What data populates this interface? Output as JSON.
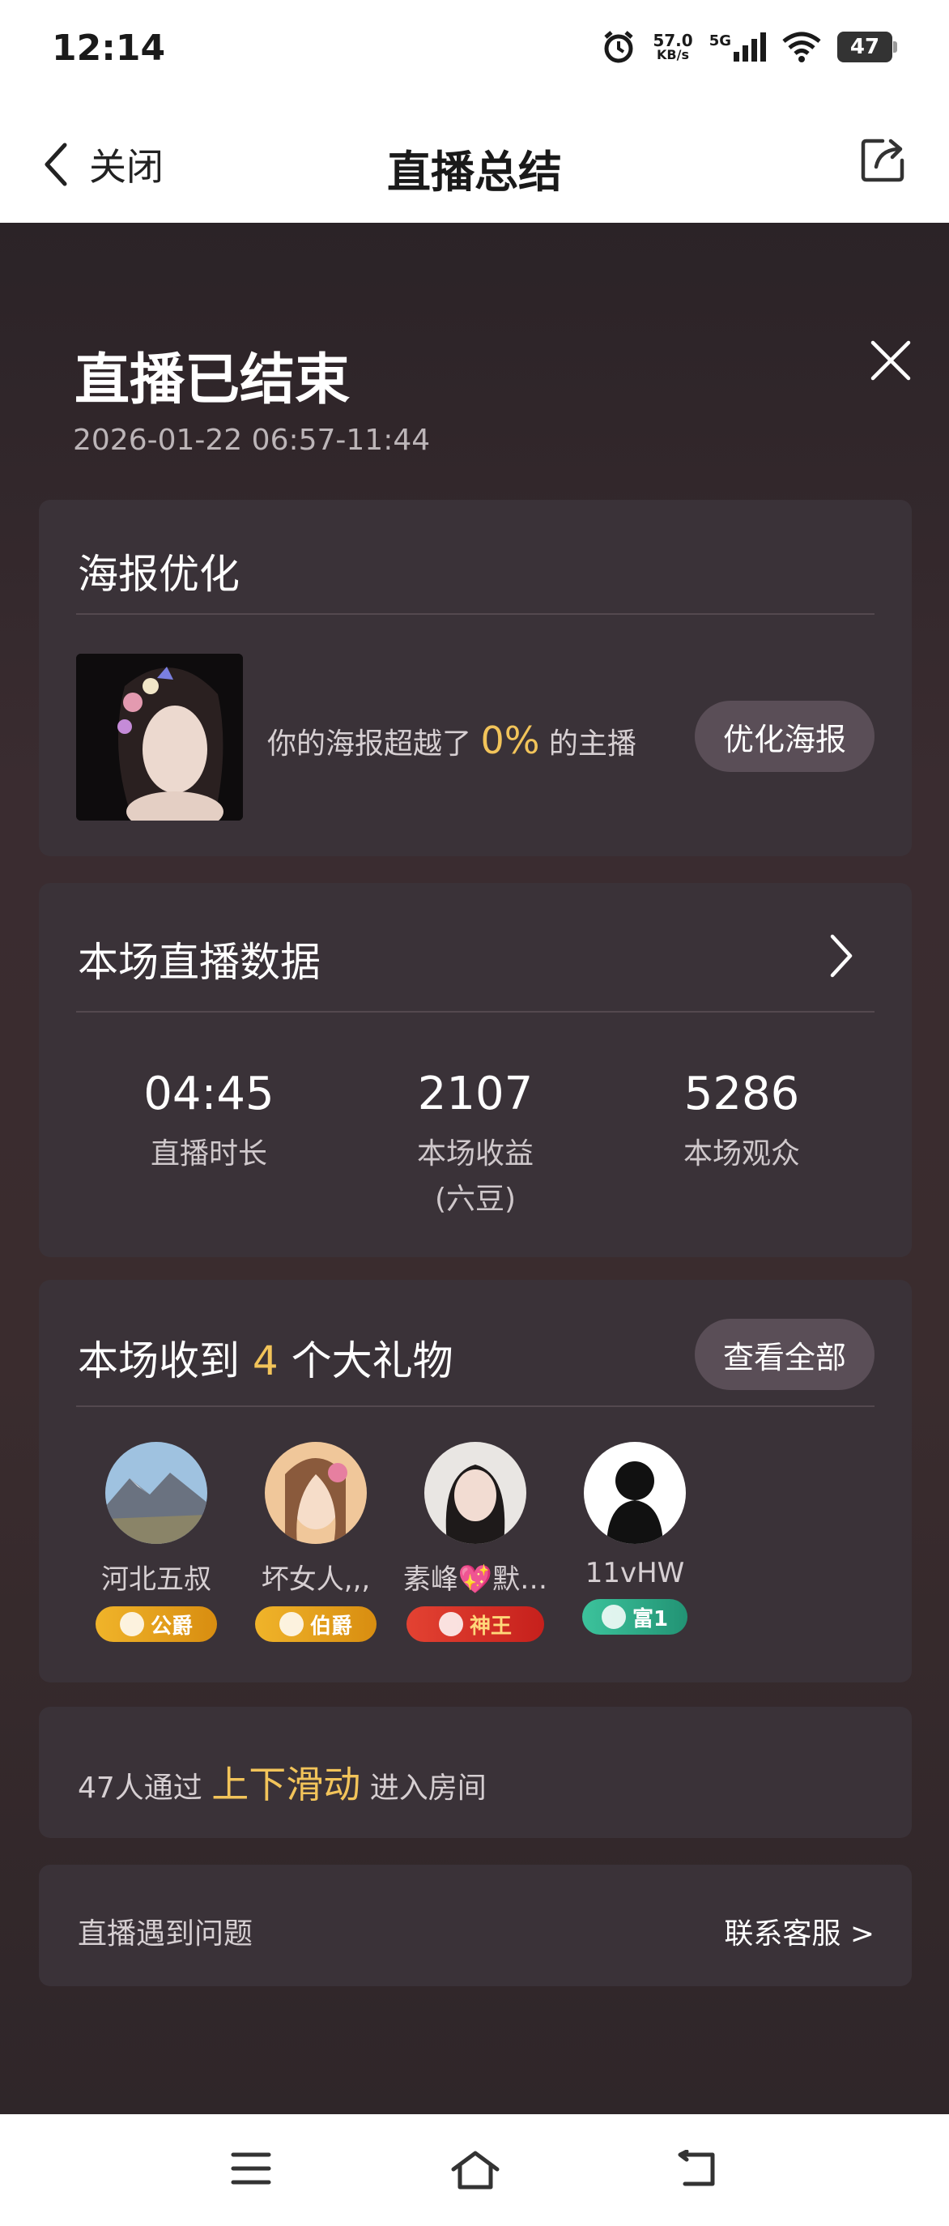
{
  "status_bar": {
    "time": "12:14",
    "net_speed_value": "57.0",
    "net_speed_unit": "KB/s",
    "network": "5G",
    "battery": "47"
  },
  "nav": {
    "back_label": "关闭",
    "title": "直播总结"
  },
  "summary": {
    "title": "直播已结束",
    "time_range": "2026-01-22 06:57-11:44"
  },
  "poster": {
    "title": "海报优化",
    "text_before": "你的海报超越了",
    "percent": "0%",
    "text_after": "的主播",
    "button": "优化海报"
  },
  "stats": {
    "title": "本场直播数据",
    "items": [
      {
        "value": "04:45",
        "label": "直播时长"
      },
      {
        "value": "2107",
        "label": "本场收益\n(六豆)"
      },
      {
        "value": "5286",
        "label": "本场观众"
      }
    ]
  },
  "gifts": {
    "title_before": "本场收到",
    "count": "4",
    "title_after": "个大礼物",
    "button": "查看全部",
    "gifters": [
      {
        "name": "河北五叔",
        "badge": "公爵",
        "badge_color": "#e6a41a"
      },
      {
        "name": "坏女人,,,",
        "badge": "伯爵",
        "badge_color": "#e6a41a"
      },
      {
        "name": "素峰💖默…",
        "badge": "神王",
        "badge_color": "#e03a2a"
      },
      {
        "name": "11vHW",
        "badge": "富1",
        "badge_color": "#2fae8a"
      }
    ]
  },
  "swipe": {
    "prefix": "47人通过",
    "highlight": "上下滑动",
    "suffix": "进入房间"
  },
  "issue": {
    "left": "直播遇到问题",
    "right": "联系客服 >"
  },
  "icons": {
    "back": "chevron-left-icon",
    "share": "share-icon",
    "close": "close-icon",
    "arrow": "chevron-right-icon",
    "menu": "menu-icon",
    "home": "home-icon",
    "return": "return-icon"
  }
}
